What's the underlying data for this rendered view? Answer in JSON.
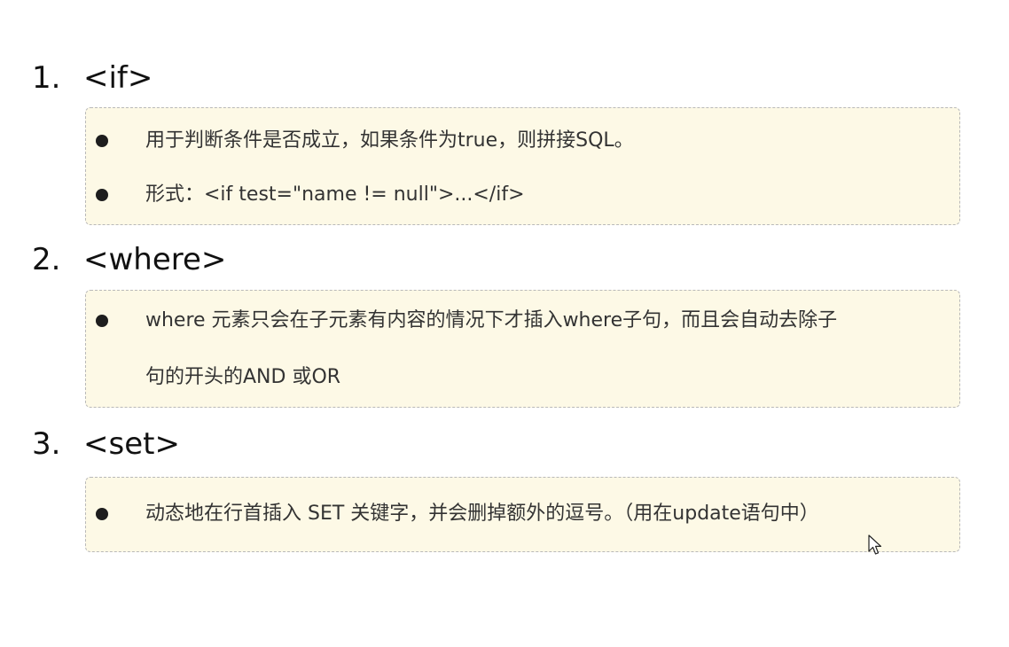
{
  "sections": [
    {
      "number": "1.",
      "title": "<if>",
      "bullets": [
        "用于判断条件是否成立，如果条件为true，则拼接SQL。",
        "形式：<if test=\"name != null\">...</if>"
      ]
    },
    {
      "number": "2.",
      "title": "<where>",
      "bullets": [
        "where 元素只会在子元素有内容的情况下才插入where子句，而且会自动去除子"
      ],
      "continuation": "句的开头的AND 或OR"
    },
    {
      "number": "3.",
      "title": "<set>",
      "bullets": [
        "动态地在行首插入 SET 关键字，并会删掉额外的逗号。（用在update语句中）"
      ]
    }
  ],
  "icons": {
    "cursor": "mouse-pointer-icon"
  },
  "colors": {
    "box_background": "#fdf9e6",
    "box_border": "#b9b9b9",
    "text": "#333333",
    "heading": "#111111"
  }
}
